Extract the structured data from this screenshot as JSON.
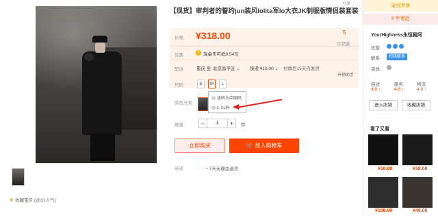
{
  "product": {
    "title": "【现货】审判者的誓约jun装风lolita军lo大衣JK制服版情侣装套装",
    "share_text": "分享"
  },
  "price": {
    "label": "价格",
    "value": "¥318.00",
    "sales_count": "5",
    "sales_label": "月销量"
  },
  "promo": {
    "label": "优惠",
    "icon_text": "¥",
    "text": "淘金币可抵9.54元"
  },
  "shipping": {
    "label": "配送",
    "from": "重庆 至",
    "to": "北京昌平区 ⌄",
    "method": "快递 ¥10.00 ⌄",
    "time": "付款后15天内发货",
    "sales_assistant": "只销助手"
  },
  "size": {
    "label": "尺码",
    "options": [
      "S",
      "M",
      "L"
    ],
    "selected": "M"
  },
  "color": {
    "label": "颜色分类",
    "popup_items": [
      "该码为中国码",
      "L-XL码"
    ]
  },
  "quantity": {
    "label": "数量",
    "value": "1",
    "minus": "−",
    "plus": "+",
    "unit": "件"
  },
  "actions": {
    "buy_now": "立即购买",
    "add_to_cart": "加入购物车"
  },
  "commitment": {
    "label": "承诺",
    "text": "7天无理由退货"
  },
  "gallery": {
    "favorite_text": "收藏宝贝 (2931人气)"
  },
  "shop": {
    "crown_text": "皇冠卖家",
    "years_text": "8 年老店",
    "name": "YourHighness永恒殿阿",
    "credit_label": "信誉:",
    "contact_label": "联系:",
    "contact_button": "和我联系",
    "quals_label": "资质:",
    "score_labels": [
      "描述",
      "服务",
      "物流"
    ],
    "score_values": [
      "4.8 ↑",
      "4.8 ↑",
      "4.9 ↑"
    ],
    "enter_shop": "进入店铺",
    "favorite_shop": "收藏店铺"
  },
  "recommendations": {
    "title": "看了又看",
    "prices": [
      "¥10.00",
      "¥38.00",
      "¥108.00",
      "¥48.00"
    ]
  },
  "colors": {
    "accent": "#ff4400",
    "price_bg": "#fff2e8",
    "badge_blue": "#3b91ea"
  }
}
